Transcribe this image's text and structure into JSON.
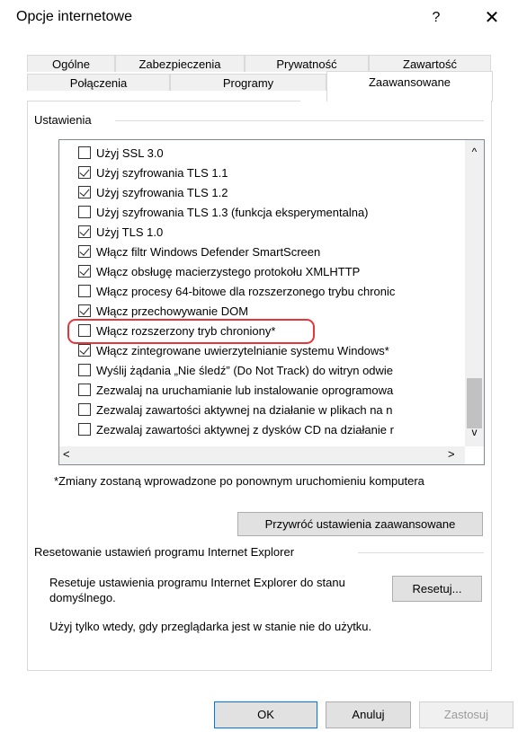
{
  "window": {
    "title": "Opcje internetowe",
    "help_glyph": "?",
    "close_glyph": "✕"
  },
  "tabs": {
    "row1": [
      "Ogólne",
      "Zabezpieczenia",
      "Prywatność",
      "Zawartość"
    ],
    "row2": [
      "Połączenia",
      "Programy"
    ],
    "active": "Zaawansowane"
  },
  "settings": {
    "group_label": "Ustawienia",
    "items": [
      {
        "label": "Użyj SSL 3.0",
        "checked": false
      },
      {
        "label": "Użyj szyfrowania TLS 1.1",
        "checked": true
      },
      {
        "label": "Użyj szyfrowania TLS 1.2",
        "checked": true
      },
      {
        "label": "Użyj szyfrowania TLS 1.3 (funkcja eksperymentalna)",
        "checked": false
      },
      {
        "label": "Użyj TLS 1.0",
        "checked": true
      },
      {
        "label": "Włącz filtr Windows Defender SmartScreen",
        "checked": true
      },
      {
        "label": "Włącz obsługę macierzystego protokołu XMLHTTP",
        "checked": true
      },
      {
        "label": "Włącz procesy 64-bitowe dla rozszerzonego trybu chronic",
        "checked": false
      },
      {
        "label": "Włącz przechowywanie DOM",
        "checked": true
      },
      {
        "label": "Włącz rozszerzony tryb chroniony*",
        "checked": false
      },
      {
        "label": "Włącz zintegrowane uwierzytelnianie systemu Windows*",
        "checked": true
      },
      {
        "label": "Wyślij żądania „Nie śledź” (Do Not Track) do witryn odwie",
        "checked": false
      },
      {
        "label": "Zezwalaj na uruchamianie lub instalowanie oprogramowa",
        "checked": false
      },
      {
        "label": "Zezwalaj zawartości aktywnej na działanie w plikach na n",
        "checked": false
      },
      {
        "label": "Zezwalaj zawartości aktywnej z dysków CD na działanie r",
        "checked": false
      }
    ],
    "scroll_up": "^",
    "scroll_down": "v",
    "scroll_left": "<",
    "scroll_right": ">",
    "note": "*Zmiany zostaną wprowadzone po ponownym uruchomieniu komputera",
    "restore_button": "Przywróć ustawienia zaawansowane"
  },
  "reset": {
    "group_label": "Resetowanie ustawień programu Internet Explorer",
    "description": "Resetuje ustawienia programu Internet Explorer do stanu domyślnego.",
    "button": "Resetuj...",
    "warning": "Użyj tylko wtedy, gdy przeglądarka jest w stanie nie do użytku."
  },
  "footer": {
    "ok": "OK",
    "cancel": "Anuluj",
    "apply": "Zastosuj"
  },
  "colors": {
    "highlight": "#e8353a",
    "ok_border": "#0078d7"
  }
}
